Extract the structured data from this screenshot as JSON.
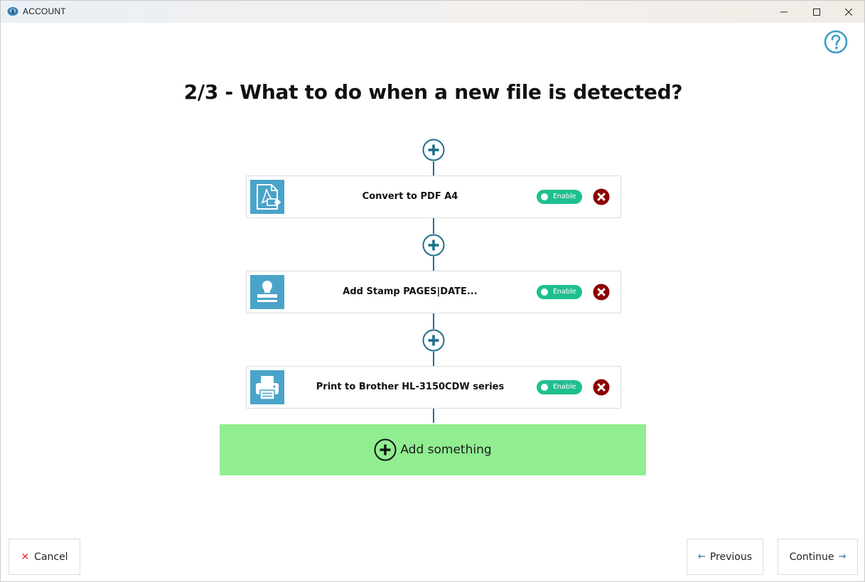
{
  "window": {
    "title": "ACCOUNT"
  },
  "page": {
    "title": "2/3 - What to do when a new file is detected?"
  },
  "steps": [
    {
      "label": "Convert to PDF A4",
      "icon": "pdf-convert-icon",
      "toggle_label": "Enable",
      "enabled": true
    },
    {
      "label": "Add Stamp PAGES|DATE...",
      "icon": "stamp-icon",
      "toggle_label": "Enable",
      "enabled": true
    },
    {
      "label": "Print to Brother HL-3150CDW series",
      "icon": "printer-icon",
      "toggle_label": "Enable",
      "enabled": true
    }
  ],
  "add_something": {
    "label": "Add something"
  },
  "footer": {
    "cancel_label": "Cancel",
    "previous_label": "Previous",
    "continue_label": "Continue",
    "previous_arrow": "←",
    "continue_arrow": "→",
    "cancel_mark": "✕"
  },
  "colors": {
    "accent": "#1f6f8f",
    "step_icon_bg": "#4aa3c8",
    "toggle_on": "#1fbf8f",
    "remove": "#8b0000",
    "add_bg": "#90ee90"
  }
}
